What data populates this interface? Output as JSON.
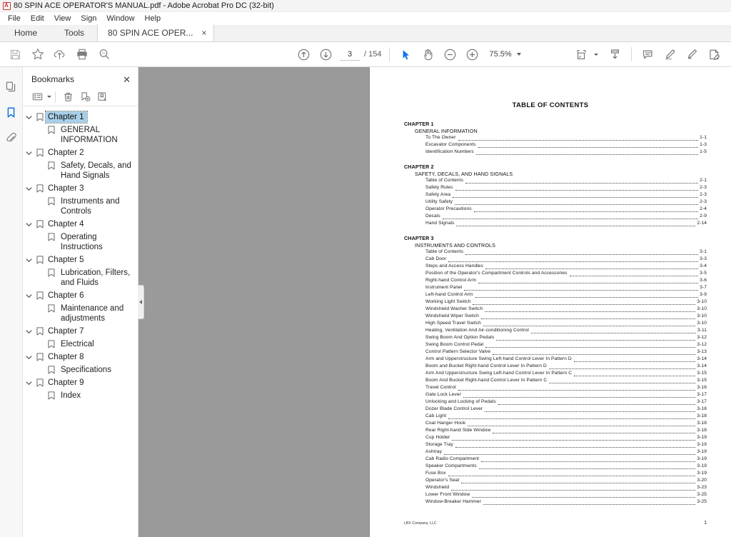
{
  "window": {
    "title": "80 SPIN ACE OPERATOR'S MANUAL.pdf - Adobe Acrobat Pro DC (32-bit)",
    "app_icon": "pdf-file-icon"
  },
  "menubar": {
    "items": [
      {
        "label": "File"
      },
      {
        "label": "Edit"
      },
      {
        "label": "View"
      },
      {
        "label": "Sign"
      },
      {
        "label": "Window"
      },
      {
        "label": "Help"
      }
    ]
  },
  "tabs": {
    "home": "Home",
    "tools": "Tools",
    "document": "80 SPIN ACE OPER...",
    "close_glyph": "×"
  },
  "toolbar": {
    "save_title": "Save File",
    "star_title": "Add to Favorites",
    "upload_title": "Upload / Share",
    "print_title": "Print File",
    "search_title": "Find",
    "prev_page_title": "Previous Page",
    "next_page_title": "Next Page",
    "page_current": "3",
    "page_total": "/ 154",
    "select_tool_title": "Select Tool",
    "hand_tool_title": "Hand Tool",
    "zoom_out_title": "Zoom Out",
    "zoom_in_title": "Zoom In",
    "zoom_level": "75.5%",
    "fit_page_title": "Fit Page",
    "scroll_mode_title": "Page Display",
    "comment_title": "Add Comment",
    "highlight_title": "Highlight Text",
    "draw_title": "Draw Free Form",
    "sign_title": "Fill & Sign"
  },
  "navrail": {
    "items": [
      {
        "name": "page-thumbnails",
        "active": false
      },
      {
        "name": "bookmarks",
        "active": true
      },
      {
        "name": "attachments",
        "active": false
      }
    ]
  },
  "bookmarks_panel": {
    "title": "Bookmarks",
    "close_glyph": "✕",
    "toolbar": {
      "options_title": "Options",
      "delete_title": "Delete Selected Bookmarks",
      "new_title": "New Bookmark",
      "page_title": "Expand Current Bookmark"
    },
    "items": [
      {
        "label": "Chapter 1",
        "level": 0,
        "expanded": true,
        "selected": true
      },
      {
        "label": "GENERAL INFORMATION",
        "level": 1,
        "expanded": false,
        "selected": false
      },
      {
        "label": "Chapter 2",
        "level": 0,
        "expanded": true,
        "selected": false
      },
      {
        "label": "Safety, Decals, and Hand Signals",
        "level": 1,
        "expanded": false,
        "selected": false
      },
      {
        "label": "Chapter 3",
        "level": 0,
        "expanded": true,
        "selected": false
      },
      {
        "label": "Instruments and Controls",
        "level": 1,
        "expanded": false,
        "selected": false
      },
      {
        "label": "Chapter 4",
        "level": 0,
        "expanded": true,
        "selected": false
      },
      {
        "label": "Operating Instructions",
        "level": 1,
        "expanded": false,
        "selected": false
      },
      {
        "label": "Chapter 5",
        "level": 0,
        "expanded": true,
        "selected": false
      },
      {
        "label": "Lubrication, Filters, and Fluids",
        "level": 1,
        "expanded": false,
        "selected": false
      },
      {
        "label": "Chapter 6",
        "level": 0,
        "expanded": true,
        "selected": false
      },
      {
        "label": "Maintenance and adjustments",
        "level": 1,
        "expanded": false,
        "selected": false
      },
      {
        "label": "Chapter 7",
        "level": 0,
        "expanded": true,
        "selected": false
      },
      {
        "label": "Electrical",
        "level": 1,
        "expanded": false,
        "selected": false
      },
      {
        "label": "Chapter 8",
        "level": 0,
        "expanded": true,
        "selected": false
      },
      {
        "label": "Specifications",
        "level": 1,
        "expanded": false,
        "selected": false
      },
      {
        "label": "Chapter 9",
        "level": 0,
        "expanded": true,
        "selected": false
      },
      {
        "label": "Index",
        "level": 1,
        "expanded": false,
        "selected": false
      }
    ],
    "collapse_handle_title": "Collapse Navigation Pane"
  },
  "document": {
    "title": "TABLE OF CONTENTS",
    "chapters": [
      {
        "heading": "CHAPTER 1",
        "subheading": "GENERAL INFORMATION",
        "entries": [
          {
            "name": "To The Owner",
            "page": "1-1"
          },
          {
            "name": "Excavator Components",
            "page": "1-3"
          },
          {
            "name": "Identification Numbers",
            "page": "1-5"
          }
        ]
      },
      {
        "heading": "CHAPTER 2",
        "subheading": "SAFETY, DECALS, AND HAND SIGNALS",
        "entries": [
          {
            "name": "Table of Contents",
            "page": "2-1"
          },
          {
            "name": "Safety Rules",
            "page": "2-3"
          },
          {
            "name": "Safety Area",
            "page": "2-3"
          },
          {
            "name": "Utility Safety",
            "page": "2-3"
          },
          {
            "name": "Operator Precautions",
            "page": "2-4"
          },
          {
            "name": "Decals",
            "page": "2-9"
          },
          {
            "name": "Hand Signals",
            "page": "2-14"
          }
        ]
      },
      {
        "heading": "CHAPTER 3",
        "subheading": "INSTRUMENTS AND CONTROLS",
        "entries": [
          {
            "name": "Table of Contents",
            "page": "3-1"
          },
          {
            "name": "Cab Door",
            "page": "3-3"
          },
          {
            "name": "Steps and Access Handles",
            "page": "3-4"
          },
          {
            "name": "Position of the Operator's Compartment Controls and Accessories",
            "page": "3-5"
          },
          {
            "name": "Right-hand Control Arm",
            "page": "3-6"
          },
          {
            "name": "Instrument Panel",
            "page": "3-7"
          },
          {
            "name": "Left-hand Control Arm",
            "page": "3-9"
          },
          {
            "name": "Working Light Switch",
            "page": "3-10"
          },
          {
            "name": "Windshield Washer Switch",
            "page": "3-10"
          },
          {
            "name": "Windshield Wiper Switch",
            "page": "3-10"
          },
          {
            "name": "High Speed Travel Switch",
            "page": "3-10"
          },
          {
            "name": "Heating, Ventilation And Air-conditioning Control",
            "page": "3-11"
          },
          {
            "name": "Swing Boom And Option Pedals",
            "page": "3-12"
          },
          {
            "name": "Swing Boom Control Pedal",
            "page": "3-12"
          },
          {
            "name": "Control Pattern Selector Valve",
            "page": "3-13"
          },
          {
            "name": "Arm and Upperstructure Swing Left-hand Control Lever In Pattern D",
            "page": "3-14"
          },
          {
            "name": "Boom and Bucket Right-hand Control Lever In Pattern D",
            "page": "3-14"
          },
          {
            "name": "Arm And Upperstructure Swing Left-hand Control Lever In Pattern C",
            "page": "3-15"
          },
          {
            "name": "Boom And Bucket Right-hand Control Lever In Pattern C",
            "page": "3-15"
          },
          {
            "name": "Travel Control",
            "page": "3-16"
          },
          {
            "name": "Gate Lock Lever",
            "page": "3-17"
          },
          {
            "name": "Unlocking and Locking of Pedals",
            "page": "3-17"
          },
          {
            "name": "Dozer Blade Control Lever",
            "page": "3-18"
          },
          {
            "name": "Cab Light",
            "page": "3-18"
          },
          {
            "name": "Coat Hanger Hook",
            "page": "3-18"
          },
          {
            "name": "Rear Right-hand Side Window",
            "page": "3-18"
          },
          {
            "name": "Cup Holder",
            "page": "3-19"
          },
          {
            "name": "Storage Tray",
            "page": "3-19"
          },
          {
            "name": "Ashtray",
            "page": "3-19"
          },
          {
            "name": "Cab Radio Compartment",
            "page": "3-19"
          },
          {
            "name": "Speaker Compartments",
            "page": "3-19"
          },
          {
            "name": "Fuse Box",
            "page": "3-19"
          },
          {
            "name": "Operator's Seat",
            "page": "3-20"
          },
          {
            "name": "Windshield",
            "page": "3-23"
          },
          {
            "name": "Lower Front Window",
            "page": "3-25"
          },
          {
            "name": "Window-Breaker Hammer",
            "page": "3-25"
          }
        ]
      }
    ],
    "footer_left": "LBX Company, LLC",
    "footer_right": "1"
  },
  "colors": {
    "accent": "#1473e6",
    "selection": "#a8cfe8",
    "viewport_bg": "#9a9a9a",
    "chrome_bg": "#f4f4f4",
    "pdf_red": "#c9352c"
  }
}
